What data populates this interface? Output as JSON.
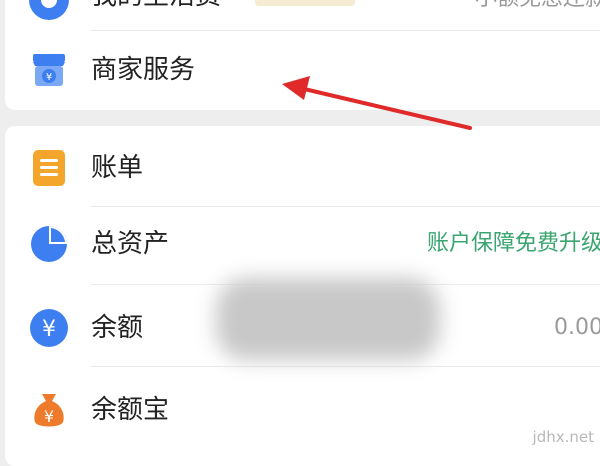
{
  "top_partial": {
    "label": "我的生活费",
    "right_text": "小额免息还款"
  },
  "merchant": {
    "label": "商家服务",
    "icon": "store-icon"
  },
  "rows": [
    {
      "label": "账单",
      "icon": "bill-icon",
      "right": ""
    },
    {
      "label": "总资产",
      "icon": "pie-chart-icon",
      "right": "账户保障免费升级"
    },
    {
      "label": "余额",
      "icon": "yuan-icon",
      "right": "0.00"
    },
    {
      "label": "余额宝",
      "icon": "money-bag-icon",
      "right": ""
    }
  ],
  "watermark": "jdhx.net",
  "colors": {
    "blue": "#3d7ff0",
    "orange": "#f3a62b",
    "orange_dark": "#ee7a2b",
    "green": "#3aa570",
    "gray": "#9a9a9a",
    "red_arrow": "#e02a2a"
  }
}
